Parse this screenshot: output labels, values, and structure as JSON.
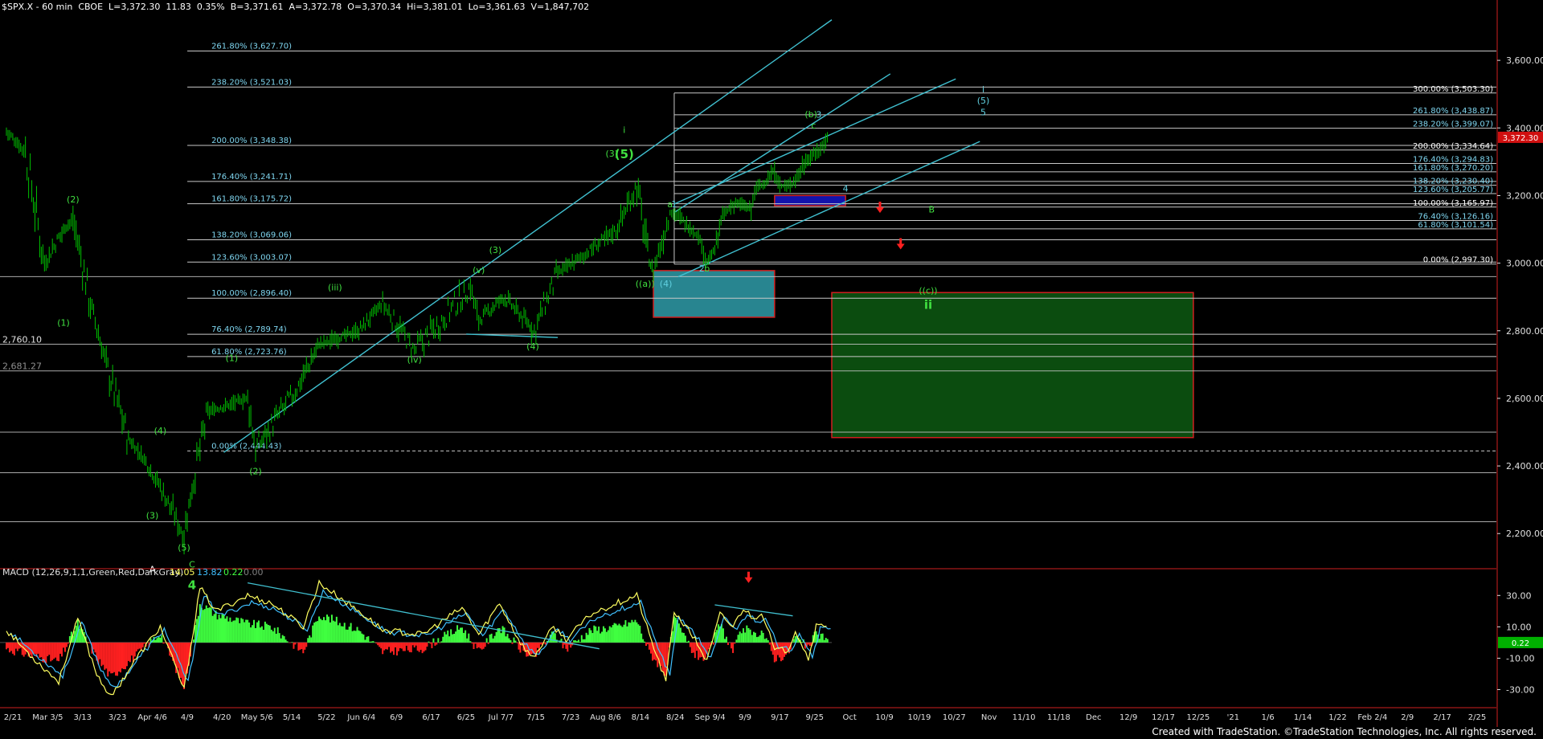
{
  "header": {
    "text": "$SPX.X - 60 min  CBOE  L=3,372.30  11.83  0.35%  B=3,371.61  A=3,372.78  O=3,370.34  Hi=3,381.01  Lo=3,361.63  V=1,847,702"
  },
  "footer": {
    "text": "Created with TradeStation. ©TradeStation Technologies, Inc. All rights reserved."
  },
  "colors": {
    "background": "#000000",
    "price_bars": "#00c000",
    "fib_line": "#c8c8c8",
    "fib_text_left": "#7fd6f0",
    "fib_text_right": "#7fd6f0",
    "channel": "#40c0d0",
    "label_green": "#40e040",
    "label_teal": "#60d0e0",
    "label_white": "#ffffff",
    "red_arrow": "#ff2020",
    "macd_pos": "#40ff40",
    "macd_neg": "#ff2020",
    "green_box": "#0c5010",
    "teal_box": "#2a8c98",
    "blue_box": "#1414b4",
    "last_price_tag": "#d01010",
    "macd_zero_tag": "#00b000"
  },
  "chart_data": [
    {
      "type": "candlestick",
      "title": "$SPX.X - 60 min",
      "price_axis": {
        "ticks": [
          "3,600.00",
          "3,400.00",
          "3,200.00",
          "3,000.00",
          "2,800.00",
          "2,600.00",
          "2,400.00",
          "2,200.00"
        ],
        "tick_values": [
          3600,
          3400,
          3200,
          3000,
          2800,
          2600,
          2400,
          2200
        ],
        "range": [
          2115,
          3750
        ],
        "last_price": "3,372.30"
      },
      "date_axis": {
        "labels": [
          "2/21",
          "Mar 3/5",
          "3/13",
          "3/23",
          "Apr 4/6",
          "4/9",
          "4/20",
          "May 5/6",
          "5/14",
          "5/22",
          "Jun 6/4",
          "6/9",
          "6/17",
          "6/25",
          "Jul 7/7",
          "7/15",
          "7/23",
          "Aug 8/6",
          "8/14",
          "8/24",
          "Sep 9/4",
          "9/9",
          "9/17",
          "9/25",
          "Oct",
          "10/9",
          "10/19",
          "10/27",
          "Nov",
          "11/10",
          "11/18",
          "Dec",
          "12/9",
          "12/17",
          "12/25",
          "'21",
          "1/6",
          "1/14",
          "1/22",
          "Feb 2/4",
          "2/9",
          "2/17",
          "2/25"
        ]
      },
      "price_path": {
        "dates": [
          "2/20",
          "2/24",
          "2/28",
          "3/3",
          "3/5",
          "3/9",
          "3/12",
          "3/16",
          "3/18",
          "3/20",
          "3/23",
          "3/24",
          "3/26",
          "3/31",
          "4/1",
          "4/6",
          "4/9",
          "4/14",
          "4/17",
          "4/21",
          "4/29",
          "5/1",
          "5/7",
          "5/13",
          "5/14",
          "5/20",
          "5/27",
          "6/3",
          "6/8",
          "6/11",
          "6/12",
          "6/16",
          "6/18",
          "6/22",
          "6/24",
          "6/26",
          "6/29",
          "7/2",
          "7/7",
          "7/13",
          "7/15",
          "7/17",
          "7/22",
          "7/24",
          "7/28",
          "7/30",
          "8/3",
          "8/6",
          "8/10",
          "8/12"
        ],
        "values": [
          3390,
          3330,
          3000,
          3100,
          3130,
          2860,
          2700,
          2480,
          2420,
          2340,
          2195,
          2340,
          2560,
          2600,
          2450,
          2620,
          2760,
          2800,
          2880,
          2740,
          2930,
          2830,
          2900,
          2820,
          2790,
          2970,
          3030,
          3100,
          3230,
          3000,
          2980,
          3150,
          3140,
          3090,
          3060,
          3000,
          3040,
          3140,
          3180,
          3160,
          3230,
          3230,
          3270,
          3230,
          3230,
          3250,
          3300,
          3320,
          3350,
          3381
        ]
      },
      "fib_levels_left": [
        {
          "label": "261.80% (3,627.70)",
          "value": 3627.7
        },
        {
          "label": "238.20% (3,521.03)",
          "value": 3521.03
        },
        {
          "label": "200.00% (3,348.38)",
          "value": 3348.38
        },
        {
          "label": "176.40% (3,241.71)",
          "value": 3241.71
        },
        {
          "label": "161.80% (3,175.72)",
          "value": 3175.72
        },
        {
          "label": "138.20% (3,069.06)",
          "value": 3069.06
        },
        {
          "label": "123.60% (3,003.07)",
          "value": 3003.07
        },
        {
          "label": "100.00% (2,896.40)",
          "value": 2896.4
        },
        {
          "label": "76.40% (2,789.74)",
          "value": 2789.74
        },
        {
          "label": "61.80% (2,723.76)",
          "value": 2723.76
        },
        {
          "label": "0.00% (2,444.43)",
          "value": 2444.43
        }
      ],
      "fib_levels_right": [
        {
          "label": "300.00% (3,503.30)",
          "value": 3503.3
        },
        {
          "label": "261.80% (3,438.87)",
          "value": 3438.87
        },
        {
          "label": "238.20% (3,399.07)",
          "value": 3399.07
        },
        {
          "label": "200.00% (3,334.64)",
          "value": 3334.64
        },
        {
          "label": "176.40% (3,294.83)",
          "value": 3294.83
        },
        {
          "label": "161.80% (3,270.20)",
          "value": 3270.2
        },
        {
          "label": "138.20% (3,230.40)",
          "value": 3230.4
        },
        {
          "label": "123.60% (3,205.77)",
          "value": 3205.77
        },
        {
          "label": "100.00% (3,165.97)",
          "value": 3165.97
        },
        {
          "label": "76.40% (3,126.16)",
          "value": 3126.16
        },
        {
          "label": "61.80% (3,101.54)",
          "value": 3101.54
        },
        {
          "label": "0.00% (2,997.30)",
          "value": 2997.3
        }
      ],
      "horizontal_levels": [
        {
          "label": "2,760.10",
          "value": 2760.1
        },
        {
          "label": "2,681.27",
          "value": 2681.27
        },
        {
          "label": "",
          "value": 2960
        },
        {
          "label": "",
          "value": 2500
        },
        {
          "label": "",
          "value": 2380
        },
        {
          "label": "",
          "value": 2235
        }
      ],
      "channel_lines": [
        {
          "from": [
            "3/28",
            2440
          ],
          "to": [
            "8/13",
            3720
          ]
        },
        {
          "from": [
            "6/17",
            3150
          ],
          "to": [
            "8/30",
            3560
          ]
        },
        {
          "from": [
            "6/17",
            3175
          ],
          "to": [
            "9/18",
            3545
          ]
        },
        {
          "from": [
            "6/18",
            2960
          ],
          "to": [
            "9/25",
            3360
          ]
        },
        {
          "from": [
            "4/28",
            2790
          ],
          "to": [
            "5/20",
            2780
          ]
        }
      ],
      "zones": [
        {
          "name": "wave ii target zone",
          "from": [
            "8/13",
            2913
          ],
          "to": [
            "11/26",
            2484
          ],
          "color": "green_box"
        },
        {
          "name": "wave 4 support zone",
          "from": [
            "6/12",
            2978
          ],
          "to": [
            "7/22",
            2840
          ],
          "color": "teal_box"
        },
        {
          "name": "wave 4 target zone",
          "from": [
            "7/22",
            3200
          ],
          "to": [
            "8/17",
            3170
          ],
          "color": "blue_box"
        }
      ],
      "wave_labels": [
        {
          "text": "(2)",
          "at": [
            "3/5",
            3180
          ],
          "color": "label_green"
        },
        {
          "text": "(1)",
          "at": [
            "3/3",
            2815
          ],
          "color": "label_green"
        },
        {
          "text": "(4)",
          "at": [
            "3/20",
            2495
          ],
          "color": "label_green"
        },
        {
          "text": "(3)",
          "at": [
            "3/19",
            2245
          ],
          "color": "label_green"
        },
        {
          "text": "(5)",
          "at": [
            "3/23",
            2150
          ],
          "color": "label_green"
        },
        {
          "text": "A",
          "at": [
            "3/19",
            2085
          ],
          "color": "label_white"
        },
        {
          "text": "C",
          "at": [
            "3/24",
            2100
          ],
          "color": "label_green"
        },
        {
          "text": "4",
          "at": [
            "3/24",
            2035
          ],
          "color": "label_green"
        },
        {
          "text": "(2)",
          "at": [
            "4/1",
            2375
          ],
          "color": "label_green"
        },
        {
          "text": "(1)",
          "at": [
            "3/29",
            2710
          ],
          "color": "label_green"
        },
        {
          "text": "(iii)",
          "at": [
            "4/11",
            2920
          ],
          "color": "label_green"
        },
        {
          "text": "(iv)",
          "at": [
            "4/21",
            2705
          ],
          "color": "label_green"
        },
        {
          "text": "(v)",
          "at": [
            "5/1",
            2970
          ],
          "color": "label_green"
        },
        {
          "text": "(3)",
          "at": [
            "5/5",
            3030
          ],
          "color": "label_green"
        },
        {
          "text": "(4)",
          "at": [
            "5/14",
            2745
          ],
          "color": "label_green"
        },
        {
          "text": "i",
          "at": [
            "6/5",
            3385
          ],
          "color": "label_green"
        },
        {
          "text": "(3)",
          "at": [
            "6/2",
            3315
          ],
          "color": "label_green"
        },
        {
          "text": "(5)",
          "at": [
            "6/5",
            3310
          ],
          "color": "label_green"
        },
        {
          "text": "((a))",
          "at": [
            "6/10",
            2930
          ],
          "color": "label_green"
        },
        {
          "text": "(4)",
          "at": [
            "6/15",
            2930
          ],
          "color": "label_teal"
        },
        {
          "text": "a",
          "at": [
            "6/16",
            3165
          ],
          "color": "label_green"
        },
        {
          "text": "1",
          "at": [
            "6/17",
            3165
          ],
          "color": "label_teal"
        },
        {
          "text": "2",
          "at": [
            "6/24",
            2975
          ],
          "color": "label_teal"
        },
        {
          "text": "b",
          "at": [
            "6/26",
            2975
          ],
          "color": "label_green"
        },
        {
          "text": "(b)",
          "at": [
            "8/5",
            3432
          ],
          "color": "label_green"
        },
        {
          "text": "3",
          "at": [
            "8/8",
            3430
          ],
          "color": "label_teal"
        },
        {
          "text": "c",
          "at": [
            "8/6",
            3398
          ],
          "color": "label_green"
        },
        {
          "text": "4",
          "at": [
            "8/17",
            3212
          ],
          "color": "label_teal"
        },
        {
          "text": "i",
          "at": [
            "9/26",
            3505
          ],
          "color": "label_teal"
        },
        {
          "text": "(5)",
          "at": [
            "9/26",
            3472
          ],
          "color": "label_teal"
        },
        {
          "text": "5",
          "at": [
            "9/26",
            3438
          ],
          "color": "label_teal"
        },
        {
          "text": "B",
          "at": [
            "9/11",
            3150
          ],
          "color": "label_green"
        },
        {
          "text": "((c))",
          "at": [
            "9/10",
            2910
          ],
          "color": "label_green"
        },
        {
          "text": "ii",
          "at": [
            "9/10",
            2865
          ],
          "color": "label_green"
        }
      ],
      "price_arrows": [
        {
          "at": [
            "8/27",
            3158
          ]
        },
        {
          "at": [
            "9/2",
            3050
          ]
        }
      ]
    },
    {
      "type": "bar",
      "title": "MACD (12,26,9,1,1,Green,Red,DarkGray)",
      "readouts": [
        "14.05",
        "13.82",
        "0.22",
        "0.00"
      ],
      "axis": {
        "ticks": [
          "30.00",
          "10.00",
          "-10.00",
          "-30.00"
        ],
        "tick_values": [
          30,
          10,
          -10,
          -30
        ],
        "range": [
          -40,
          45
        ],
        "zero_tag": "0.22"
      },
      "macd_line": {
        "dates": [
          "2/20",
          "2/25",
          "3/2",
          "3/6",
          "3/10",
          "3/13",
          "3/17",
          "3/20",
          "3/23",
          "3/25",
          "3/27",
          "3/31",
          "4/3",
          "4/7",
          "4/9",
          "4/14",
          "4/17",
          "4/22",
          "4/27",
          "5/1",
          "5/6",
          "5/11",
          "5/14",
          "5/19",
          "5/22",
          "5/28",
          "6/3",
          "6/8",
          "6/11",
          "6/15",
          "6/17",
          "6/22",
          "6/26",
          "7/1",
          "7/6",
          "7/10",
          "7/14",
          "7/17",
          "7/22",
          "7/27",
          "7/30",
          "8/4",
          "8/7",
          "8/12"
        ],
        "values": [
          8,
          -8,
          -25,
          15,
          -20,
          -35,
          -10,
          10,
          -30,
          35,
          20,
          30,
          25,
          10,
          38,
          20,
          8,
          5,
          22,
          5,
          25,
          0,
          -10,
          10,
          2,
          18,
          25,
          30,
          5,
          -25,
          20,
          2,
          -12,
          18,
          10,
          22,
          15,
          20,
          -5,
          -5,
          8,
          -10,
          10,
          12
        ]
      },
      "histogram_pattern": {
        "dates": [
          "2/20",
          "2/25",
          "3/2",
          "3/6",
          "3/10",
          "3/13",
          "3/17",
          "3/20",
          "3/23",
          "3/25",
          "3/27",
          "3/31",
          "4/3",
          "4/7",
          "4/9",
          "4/14",
          "4/17",
          "4/22",
          "4/27",
          "5/1",
          "5/6",
          "5/11",
          "5/14",
          "5/19",
          "5/22",
          "5/28",
          "6/3",
          "6/8",
          "6/11",
          "6/15",
          "6/17",
          "6/22",
          "6/26",
          "7/1",
          "7/6",
          "7/10",
          "7/14",
          "7/17",
          "7/22",
          "7/27",
          "7/30",
          "8/4",
          "8/7",
          "8/12"
        ],
        "values": [
          -4,
          -8,
          -12,
          12,
          -10,
          -22,
          -8,
          6,
          -28,
          25,
          18,
          12,
          10,
          -6,
          18,
          8,
          -6,
          -4,
          10,
          -6,
          10,
          -4,
          -10,
          6,
          -4,
          8,
          10,
          14,
          -6,
          -20,
          15,
          -8,
          -10,
          12,
          -6,
          10,
          4,
          8,
          -10,
          -8,
          4,
          -4,
          6,
          2
        ]
      },
      "arrow": {
        "at": [
          "7/12",
          40
        ]
      }
    }
  ]
}
